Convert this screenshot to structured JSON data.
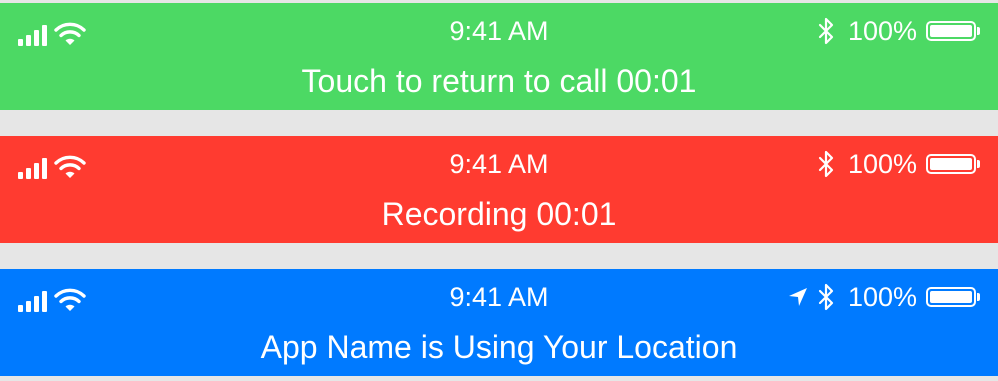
{
  "banners": [
    {
      "status": {
        "time": "9:41 AM",
        "battery": "100%",
        "battery_level": 1.0,
        "location_services": false
      },
      "message": "Touch to return to call 00:01",
      "color": "#4cd964"
    },
    {
      "status": {
        "time": "9:41 AM",
        "battery": "100%",
        "battery_level": 1.0,
        "location_services": false
      },
      "message": "Recording 00:01",
      "color": "#ff3b30"
    },
    {
      "status": {
        "time": "9:41 AM",
        "battery": "100%",
        "battery_level": 1.0,
        "location_services": true
      },
      "message": "App Name is Using Your Location",
      "color": "#007aff"
    }
  ],
  "icons": [
    "signal-icon",
    "wifi-icon",
    "location-arrow-icon",
    "bluetooth-icon",
    "battery-icon"
  ],
  "background_color": "#e6e6e6"
}
